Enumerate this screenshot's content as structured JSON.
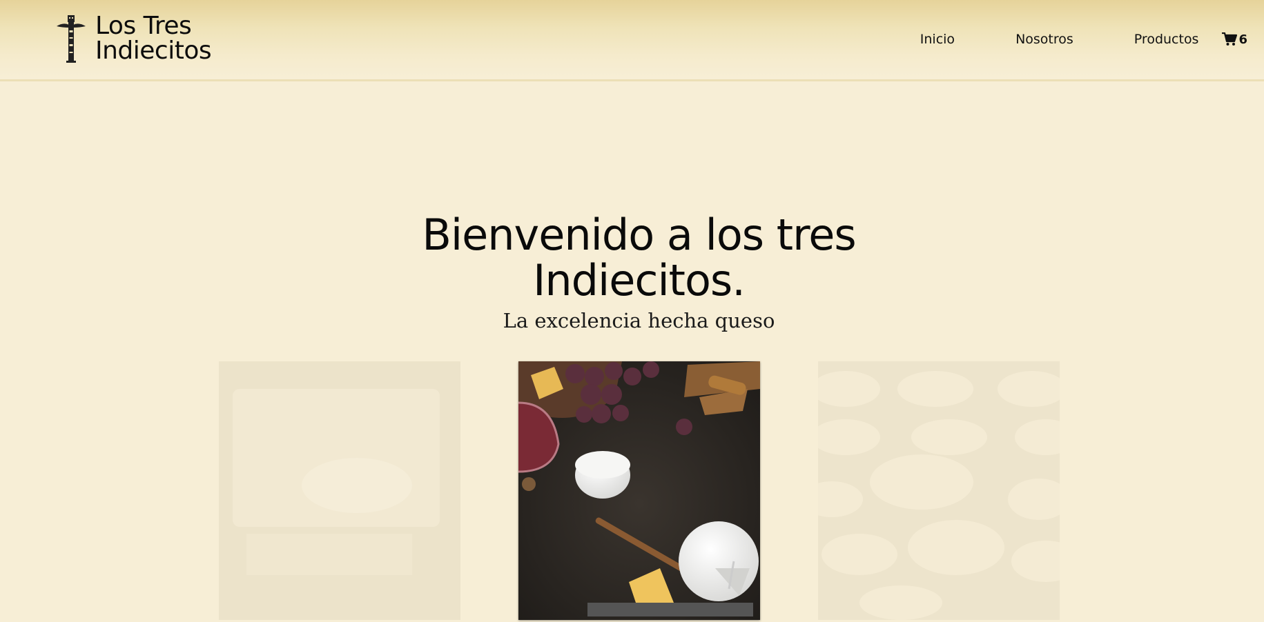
{
  "header": {
    "brand_line1": "Los Tres",
    "brand_line2": "Indiecitos",
    "nav": {
      "inicio": "Inicio",
      "nosotros": "Nosotros",
      "productos": "Productos"
    },
    "cart_count": "6"
  },
  "hero": {
    "title_line1": "Bienvenido a los tres",
    "title_line2": "Indiecitos.",
    "subtitle": "La excelencia hecha queso"
  },
  "icons": {
    "logo": "totem-icon",
    "cart": "shopping-cart-icon"
  },
  "colors": {
    "background": "#f7eed6",
    "header_top": "#e6d39a",
    "text": "#111111"
  }
}
